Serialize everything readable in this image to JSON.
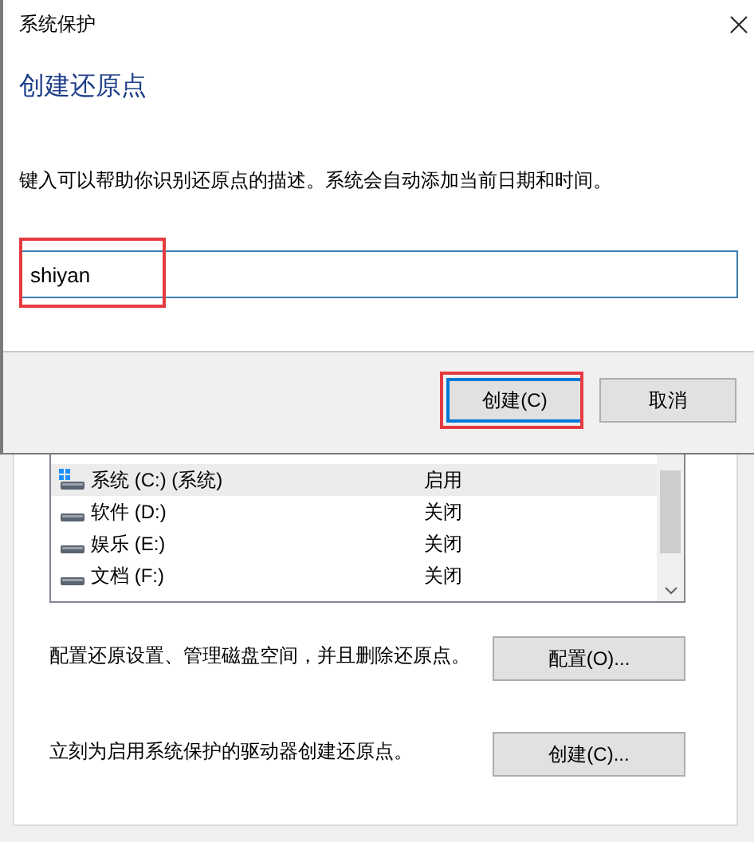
{
  "dialog": {
    "title": "系统保护",
    "heading": "创建还原点",
    "description": "键入可以帮助你识别还原点的描述。系统会自动添加当前日期和时间。",
    "input": {
      "value": "shiyan",
      "highlighted": true
    },
    "buttons": [
      {
        "label": "创建(C)",
        "default": true,
        "highlighted": true
      },
      {
        "label": "取消",
        "default": false,
        "highlighted": false
      }
    ]
  },
  "background": {
    "drives_table": {
      "rows": [
        {
          "kind": "system",
          "name": "系统 (C:) (系统)",
          "protection": "启用",
          "selected": true
        },
        {
          "kind": "drive",
          "name": "软件 (D:)",
          "protection": "关闭",
          "selected": false
        },
        {
          "kind": "drive",
          "name": "娱乐 (E:)",
          "protection": "关闭",
          "selected": false
        },
        {
          "kind": "drive",
          "name": "文档 (F:)",
          "protection": "关闭",
          "selected": false
        }
      ]
    },
    "actions": [
      {
        "text": "配置还原设置、管理磁盘空间，并且删除还原点。",
        "button": "配置(O)..."
      },
      {
        "text": "立刻为启用系统保护的驱动器创建还原点。",
        "button": "创建(C)..."
      }
    ]
  }
}
